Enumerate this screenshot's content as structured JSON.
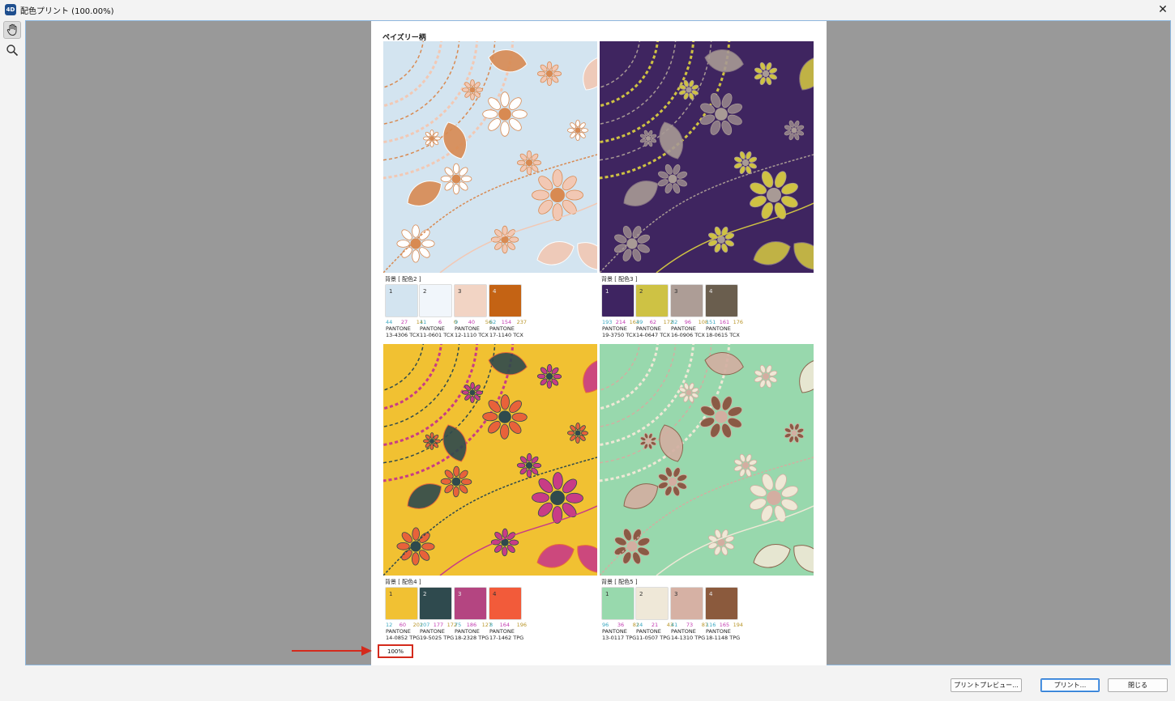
{
  "window": {
    "title": "配色プリント (100.00%)",
    "app_icon": "4D",
    "close_symbol": "✕"
  },
  "toolbar": {
    "tools": [
      {
        "name": "hand-icon",
        "active": true
      },
      {
        "name": "magnifier-icon",
        "active": false
      }
    ]
  },
  "page": {
    "title": "ペイズリー柄",
    "zoom_label": "100%",
    "variants": [
      {
        "label": "背景 [ 配色2 ]",
        "theme": {
          "bg": "#d3e4f0",
          "c1": "#f2c8b4",
          "c2": "#d88a52",
          "c3": "#ffffff"
        },
        "swatches": [
          {
            "num": "1",
            "color": "#d3e4f0",
            "rgb": [
              "44",
              "27",
              "14"
            ],
            "pantone": [
              "PANTONE",
              "13-4306 TCX"
            ]
          },
          {
            "num": "2",
            "color": "#f1f6fb",
            "rgb": [
              "11",
              "6",
              "0"
            ],
            "pantone": [
              "PANTONE",
              "11-0601 TCX"
            ]
          },
          {
            "num": "3",
            "color": "#f2d4c4",
            "rgb": [
              "9",
              "40",
              "56"
            ],
            "pantone": [
              "PANTONE",
              "12-1110 TCX"
            ]
          },
          {
            "num": "4",
            "color": "#c46314",
            "rgb": [
              "62",
              "154",
              "237"
            ],
            "pantone": [
              "PANTONE",
              "17-1140 TCX"
            ]
          }
        ]
      },
      {
        "label": "背景 [ 配色3 ]",
        "theme": {
          "bg": "#3f2560",
          "c1": "#cfc243",
          "c2": "#a89a95",
          "c3": "#8c7a86"
        },
        "swatches": [
          {
            "num": "1",
            "color": "#3e2461",
            "rgb": [
              "193",
              "214",
              "163"
            ],
            "pantone": [
              "PANTONE",
              "19-3750 TCX"
            ]
          },
          {
            "num": "2",
            "color": "#cec244",
            "rgb": [
              "49",
              "62",
              "172"
            ],
            "pantone": [
              "PANTONE",
              "14-0647 TCX"
            ]
          },
          {
            "num": "3",
            "color": "#ad9d96",
            "rgb": [
              "82",
              "96",
              "108"
            ],
            "pantone": [
              "PANTONE",
              "16-0906 TCX"
            ]
          },
          {
            "num": "4",
            "color": "#6a5e4e",
            "rgb": [
              "151",
              "161",
              "176"
            ],
            "pantone": [
              "PANTONE",
              "18-0615 TCX"
            ]
          }
        ]
      },
      {
        "label": "背景 [ 配色4 ]",
        "theme": {
          "bg": "#f1c132",
          "c1": "#c83c86",
          "c2": "#2f4a4d",
          "c3": "#e8623a"
        },
        "swatches": [
          {
            "num": "1",
            "color": "#f1c133",
            "rgb": [
              "12",
              "60",
              "201"
            ],
            "pantone": [
              "PANTONE",
              "14-0852 TPG"
            ]
          },
          {
            "num": "2",
            "color": "#2f4a4e",
            "rgb": [
              "207",
              "177",
              "172"
            ],
            "pantone": [
              "PANTONE",
              "19-5025 TPG"
            ]
          },
          {
            "num": "3",
            "color": "#b44581",
            "rgb": [
              "75",
              "186",
              "127"
            ],
            "pantone": [
              "PANTONE",
              "18-2328 TPG"
            ]
          },
          {
            "num": "4",
            "color": "#f25b3a",
            "rgb": [
              "8",
              "164",
              "196"
            ],
            "pantone": [
              "PANTONE",
              "17-1462 TPG"
            ]
          }
        ]
      },
      {
        "label": "背景 [ 配色5 ]",
        "theme": {
          "bg": "#98d8ad",
          "c1": "#efe8d6",
          "c2": "#d3aea1",
          "c3": "#8a5a45"
        },
        "swatches": [
          {
            "num": "1",
            "color": "#98d9ad",
            "rgb": [
              "96",
              "36",
              "82"
            ],
            "pantone": [
              "PANTONE",
              "13-0117 TPG"
            ]
          },
          {
            "num": "2",
            "color": "#efe8d8",
            "rgb": [
              "14",
              "21",
              "43"
            ],
            "pantone": [
              "PANTONE",
              "11-0507 TPG"
            ]
          },
          {
            "num": "3",
            "color": "#d6b1a4",
            "rgb": [
              "41",
              "73",
              "87"
            ],
            "pantone": [
              "PANTONE",
              "14-1310 TPG"
            ]
          },
          {
            "num": "4",
            "color": "#8b5a3d",
            "rgb": [
              "116",
              "165",
              "194"
            ],
            "pantone": [
              "PANTONE",
              "18-1148 TPG"
            ]
          }
        ]
      }
    ]
  },
  "buttons": {
    "print_preview": "プリントプレビュー...",
    "print": "プリント...",
    "close": "閉じる"
  },
  "colors": {
    "viewport_bg": "#999999",
    "highlight": "#d42a1c"
  }
}
